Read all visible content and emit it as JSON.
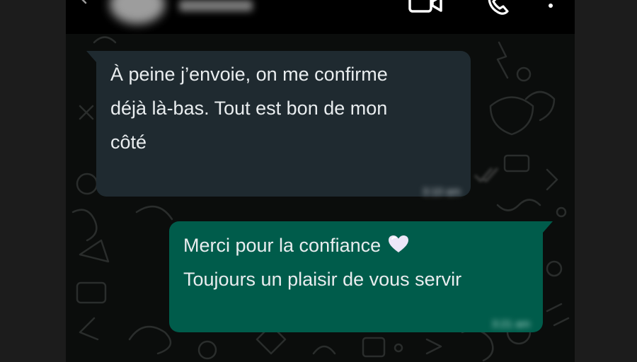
{
  "header": {
    "contact_name": "",
    "icons": [
      "back-arrow-icon",
      "avatar",
      "video-call-icon",
      "voice-call-icon",
      "more-menu-icon"
    ]
  },
  "messages": [
    {
      "direction": "incoming",
      "lines": [
        "À peine j’envoie, on me confirme",
        "déjà là-bas. Tout est bon de mon",
        "côté"
      ],
      "time": "3:10 am"
    },
    {
      "direction": "outgoing",
      "lines": [
        "Merci pour la confiance",
        "Toujours un plaisir de vous servir"
      ],
      "emoji": "white-heart-icon",
      "time": "3:21 am"
    }
  ],
  "colors": {
    "incoming_bubble": "#1f2a30",
    "outgoing_bubble": "#005c4b",
    "chat_background": "#0b0d0c",
    "text": "#e9edef"
  }
}
